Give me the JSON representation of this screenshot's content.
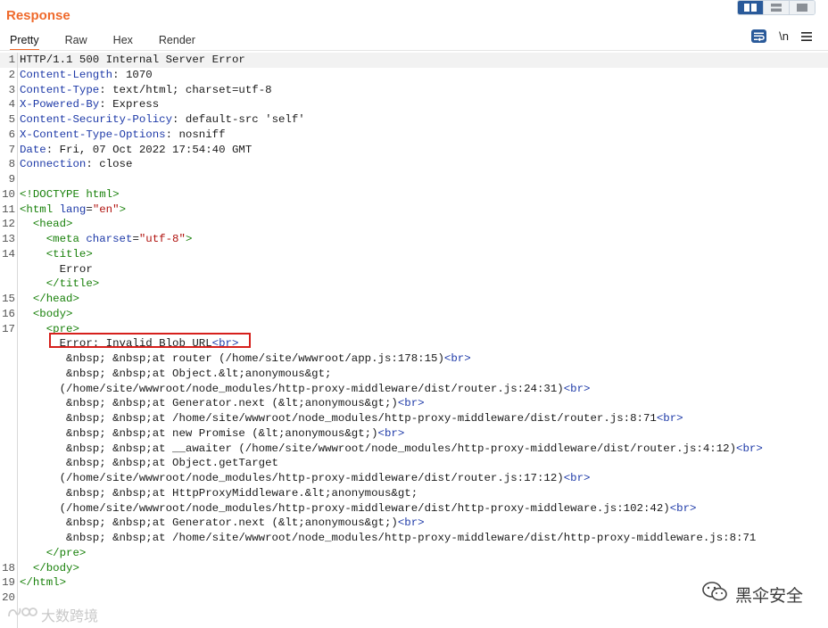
{
  "panel": {
    "title": "Response",
    "view_modes": [
      "split-view-icon",
      "horizontal-view-icon",
      "single-view-icon"
    ]
  },
  "tabs": [
    {
      "label": "Pretty",
      "active": true
    },
    {
      "label": "Raw",
      "active": false
    },
    {
      "label": "Hex",
      "active": false
    },
    {
      "label": "Render",
      "active": false
    }
  ],
  "tools": {
    "wrap_icon": "wrap-icon",
    "newline_label": "\\n",
    "menu_icon": "menu-icon"
  },
  "response_lines": [
    {
      "n": "1",
      "segs": [
        [
          "",
          "HTTP/1.1 500 Internal Server Error"
        ]
      ]
    },
    {
      "n": "2",
      "segs": [
        [
          "hk",
          "Content-Length"
        ],
        [
          "",
          ": 1070"
        ]
      ]
    },
    {
      "n": "3",
      "segs": [
        [
          "hk",
          "Content-Type"
        ],
        [
          "",
          ": text/html; charset=utf-8"
        ]
      ]
    },
    {
      "n": "4",
      "segs": [
        [
          "hk",
          "X-Powered-By"
        ],
        [
          "",
          ": Express"
        ]
      ]
    },
    {
      "n": "5",
      "segs": [
        [
          "hk",
          "Content-Security-Policy"
        ],
        [
          "",
          ": default-src 'self'"
        ]
      ]
    },
    {
      "n": "6",
      "segs": [
        [
          "hk",
          "X-Content-Type-Options"
        ],
        [
          "",
          ": nosniff"
        ]
      ]
    },
    {
      "n": "7",
      "segs": [
        [
          "hk",
          "Date"
        ],
        [
          "",
          ": Fri, 07 Oct 2022 17:54:40 GMT"
        ]
      ]
    },
    {
      "n": "8",
      "segs": [
        [
          "hk",
          "Connection"
        ],
        [
          "",
          ": close"
        ]
      ]
    },
    {
      "n": "9",
      "segs": []
    },
    {
      "n": "10",
      "segs": [
        [
          "tg",
          "<!DOCTYPE html>"
        ]
      ]
    },
    {
      "n": "11",
      "segs": [
        [
          "tg",
          "<html "
        ],
        [
          "ta",
          "lang"
        ],
        [
          "",
          "="
        ],
        [
          "tv",
          "\"en\""
        ],
        [
          "tg",
          ">"
        ]
      ]
    },
    {
      "n": "12",
      "segs": [
        [
          "",
          "  "
        ],
        [
          "tg",
          "<head>"
        ]
      ]
    },
    {
      "n": "13",
      "segs": [
        [
          "",
          "    "
        ],
        [
          "tg",
          "<meta "
        ],
        [
          "ta",
          "charset"
        ],
        [
          "",
          "="
        ],
        [
          "tv",
          "\"utf-8\""
        ],
        [
          "tg",
          ">"
        ]
      ]
    },
    {
      "n": "14",
      "segs": [
        [
          "",
          "    "
        ],
        [
          "tg",
          "<title>"
        ]
      ]
    },
    {
      "n": "",
      "segs": [
        [
          "",
          "      Error"
        ]
      ]
    },
    {
      "n": "",
      "segs": [
        [
          "",
          "    "
        ],
        [
          "tg",
          "</title>"
        ]
      ]
    },
    {
      "n": "15",
      "segs": [
        [
          "",
          "  "
        ],
        [
          "tg",
          "</head>"
        ]
      ]
    },
    {
      "n": "16",
      "segs": [
        [
          "",
          "  "
        ],
        [
          "tg",
          "<body>"
        ]
      ]
    },
    {
      "n": "17",
      "segs": [
        [
          "",
          "    "
        ],
        [
          "tg",
          "<pre>"
        ]
      ]
    },
    {
      "n": "",
      "segs": [
        [
          "",
          "      Error: Invalid Blob URL"
        ],
        [
          "br",
          "<br>"
        ]
      ]
    },
    {
      "n": "",
      "segs": [
        [
          "",
          "       &nbsp; &nbsp;at router (/home/site/wwwroot/app.js:178:15)"
        ],
        [
          "br",
          "<br>"
        ]
      ]
    },
    {
      "n": "",
      "segs": [
        [
          "",
          "       &nbsp; &nbsp;at Object.&lt;anonymous&gt;"
        ]
      ]
    },
    {
      "n": "",
      "segs": [
        [
          "",
          "      (/home/site/wwwroot/node_modules/http-proxy-middleware/dist/router.js:24:31)"
        ],
        [
          "br",
          "<br>"
        ]
      ]
    },
    {
      "n": "",
      "segs": [
        [
          "",
          "       &nbsp; &nbsp;at Generator.next (&lt;anonymous&gt;)"
        ],
        [
          "br",
          "<br>"
        ]
      ]
    },
    {
      "n": "",
      "segs": [
        [
          "",
          "       &nbsp; &nbsp;at /home/site/wwwroot/node_modules/http-proxy-middleware/dist/router.js:8:71"
        ],
        [
          "br",
          "<br>"
        ]
      ]
    },
    {
      "n": "",
      "segs": [
        [
          "",
          "       &nbsp; &nbsp;at new Promise (&lt;anonymous&gt;)"
        ],
        [
          "br",
          "<br>"
        ]
      ]
    },
    {
      "n": "",
      "segs": [
        [
          "",
          "       &nbsp; &nbsp;at __awaiter (/home/site/wwwroot/node_modules/http-proxy-middleware/dist/router.js:4:12)"
        ],
        [
          "br",
          "<br>"
        ]
      ]
    },
    {
      "n": "",
      "segs": [
        [
          "",
          "       &nbsp; &nbsp;at Object.getTarget"
        ]
      ]
    },
    {
      "n": "",
      "segs": [
        [
          "",
          "      (/home/site/wwwroot/node_modules/http-proxy-middleware/dist/router.js:17:12)"
        ],
        [
          "br",
          "<br>"
        ]
      ]
    },
    {
      "n": "",
      "segs": [
        [
          "",
          "       &nbsp; &nbsp;at HttpProxyMiddleware.&lt;anonymous&gt;"
        ]
      ]
    },
    {
      "n": "",
      "segs": [
        [
          "",
          "      (/home/site/wwwroot/node_modules/http-proxy-middleware/dist/http-proxy-middleware.js:102:42)"
        ],
        [
          "br",
          "<br>"
        ]
      ]
    },
    {
      "n": "",
      "segs": [
        [
          "",
          "       &nbsp; &nbsp;at Generator.next (&lt;anonymous&gt;)"
        ],
        [
          "br",
          "<br>"
        ]
      ]
    },
    {
      "n": "",
      "segs": [
        [
          "",
          "       &nbsp; &nbsp;at /home/site/wwwroot/node_modules/http-proxy-middleware/dist/http-proxy-middleware.js:8:71"
        ]
      ]
    },
    {
      "n": "",
      "segs": [
        [
          "",
          "    "
        ],
        [
          "tg",
          "</pre>"
        ]
      ]
    },
    {
      "n": "18",
      "segs": [
        [
          "",
          "  "
        ],
        [
          "tg",
          "</body>"
        ]
      ]
    },
    {
      "n": "19",
      "segs": [
        [
          "tg",
          "</html>"
        ]
      ]
    },
    {
      "n": "20",
      "segs": []
    }
  ],
  "watermarks": {
    "left": "大数跨境",
    "right": "黑伞安全"
  },
  "colors": {
    "accent": "#ef6a2c",
    "header_key": "#1e3aa8",
    "tag": "#19810b",
    "attr_value": "#b0120e",
    "highlight_box": "#d6201c"
  }
}
